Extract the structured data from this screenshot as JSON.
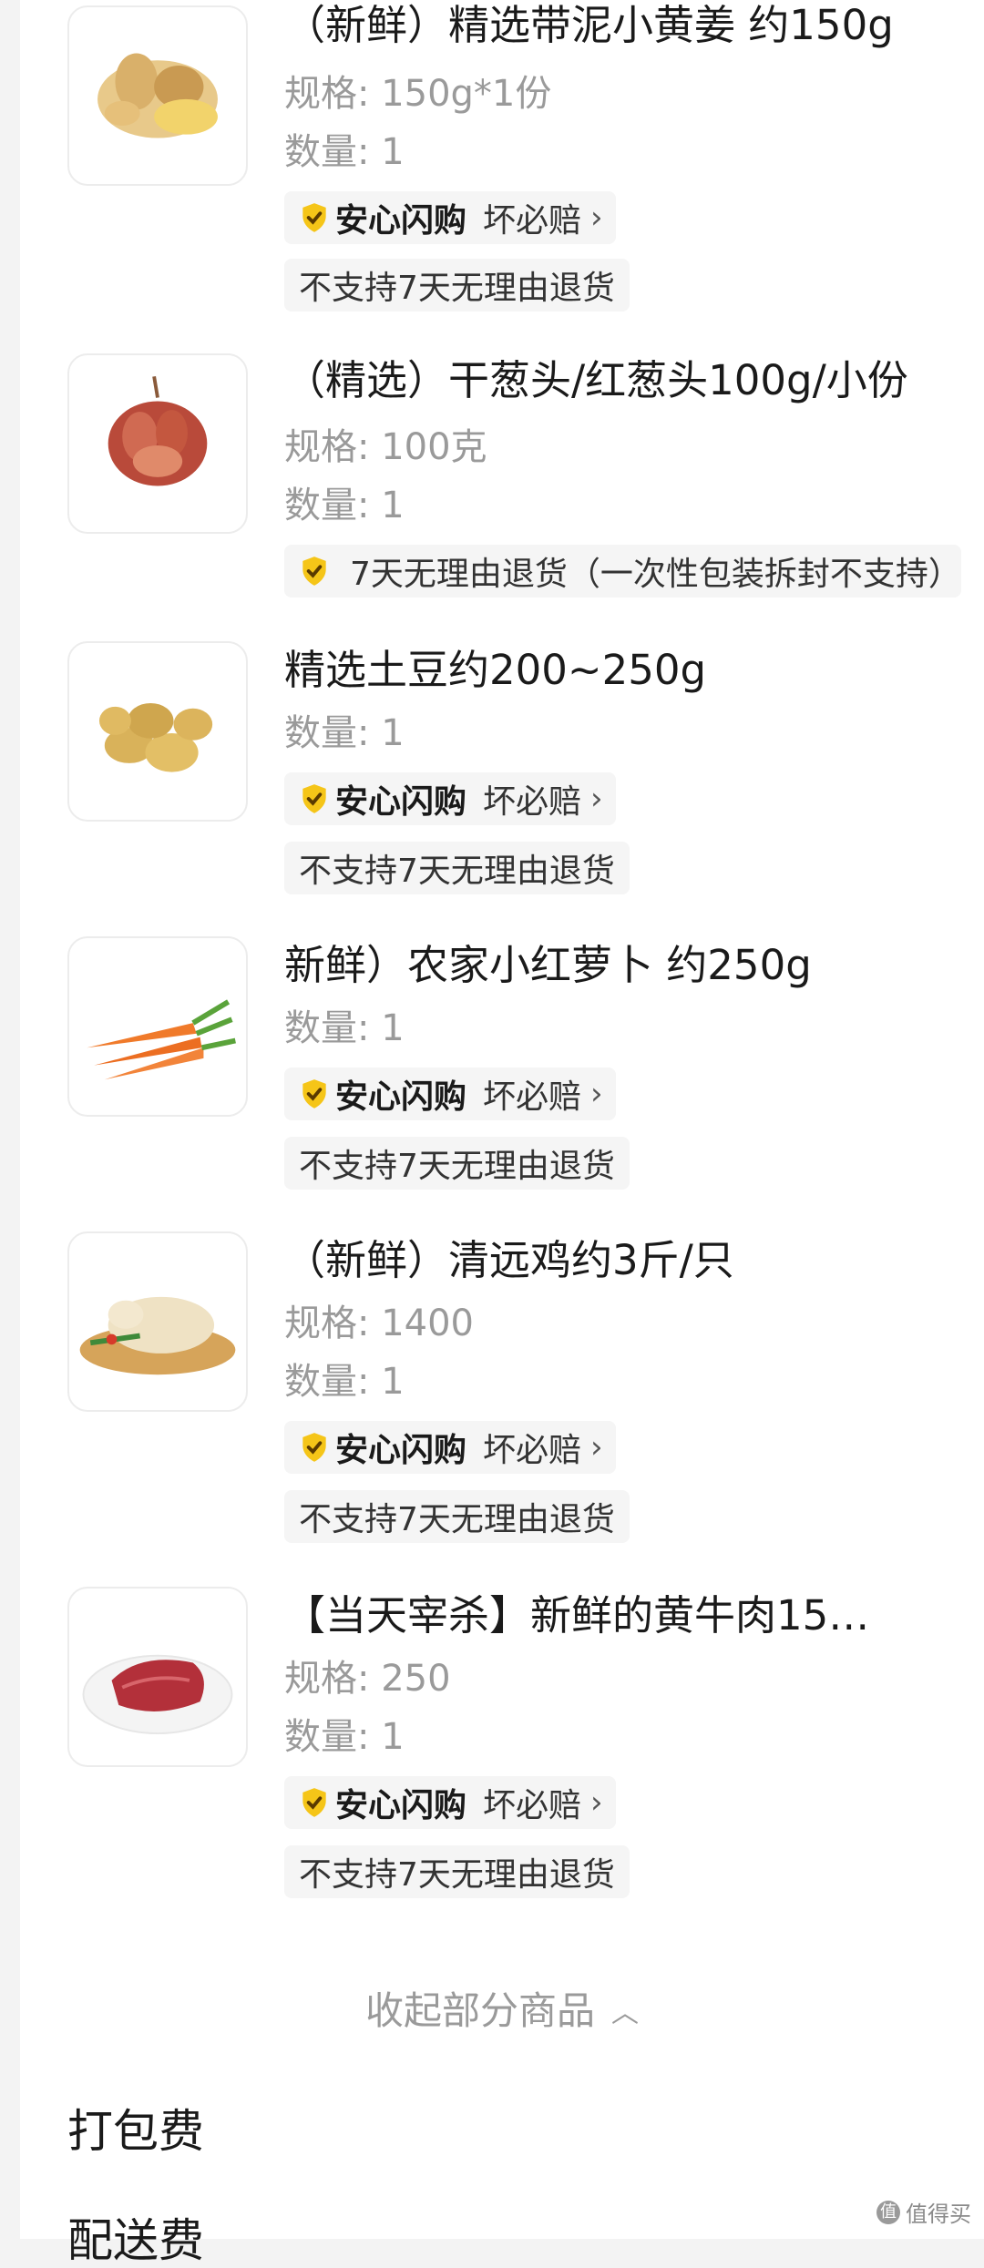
{
  "products": [
    {
      "title": "（新鲜）精选带泥小黄姜 约150g",
      "spec": "规格: 150g*1份",
      "qty": "数量: 1",
      "badge": {
        "brand": "安心闪购",
        "sub": "坏必赔",
        "chevron": "›"
      },
      "tag": "不支持7天无理由退货",
      "image_icon": "ginger-image"
    },
    {
      "title": "（精选）干葱头/红葱头100g/小份",
      "spec": "规格: 100克",
      "qty": "数量: 1",
      "badge": {
        "text": "7天无理由退货（一次性包装拆封不支持）"
      },
      "image_icon": "shallot-image"
    },
    {
      "title": "精选土豆约200~250g",
      "qty": "数量: 1",
      "badge": {
        "brand": "安心闪购",
        "sub": "坏必赔",
        "chevron": "›"
      },
      "tag": "不支持7天无理由退货",
      "image_icon": "potato-image"
    },
    {
      "title": "新鲜）农家小红萝卜 约250g",
      "qty": "数量: 1",
      "badge": {
        "brand": "安心闪购",
        "sub": "坏必赔",
        "chevron": "›"
      },
      "tag": "不支持7天无理由退货",
      "image_icon": "carrot-image"
    },
    {
      "title": "（新鲜）清远鸡约3斤/只",
      "spec": "规格: 1400",
      "qty": "数量: 1",
      "badge": {
        "brand": "安心闪购",
        "sub": "坏必赔",
        "chevron": "›"
      },
      "tag": "不支持7天无理由退货",
      "image_icon": "chicken-image"
    },
    {
      "title": "【当天宰杀】新鲜的黄牛肉15…",
      "spec": "规格: 250",
      "qty": "数量: 1",
      "badge": {
        "brand": "安心闪购",
        "sub": "坏必赔",
        "chevron": "›"
      },
      "tag": "不支持7天无理由退货",
      "image_icon": "beef-image"
    }
  ],
  "collapse_label": "收起部分商品",
  "collapse_icon": "chevron-up-icon",
  "fees": [
    {
      "label": "打包费"
    },
    {
      "label": "配送费"
    }
  ],
  "watermark": "值得买",
  "colors": {
    "shield_yellow": "#f5c518",
    "shield_check": "#5a3a00",
    "page_bg": "#f3f3f3",
    "tag_bg": "#f5f5f5",
    "muted_text": "#9a9a9a"
  }
}
